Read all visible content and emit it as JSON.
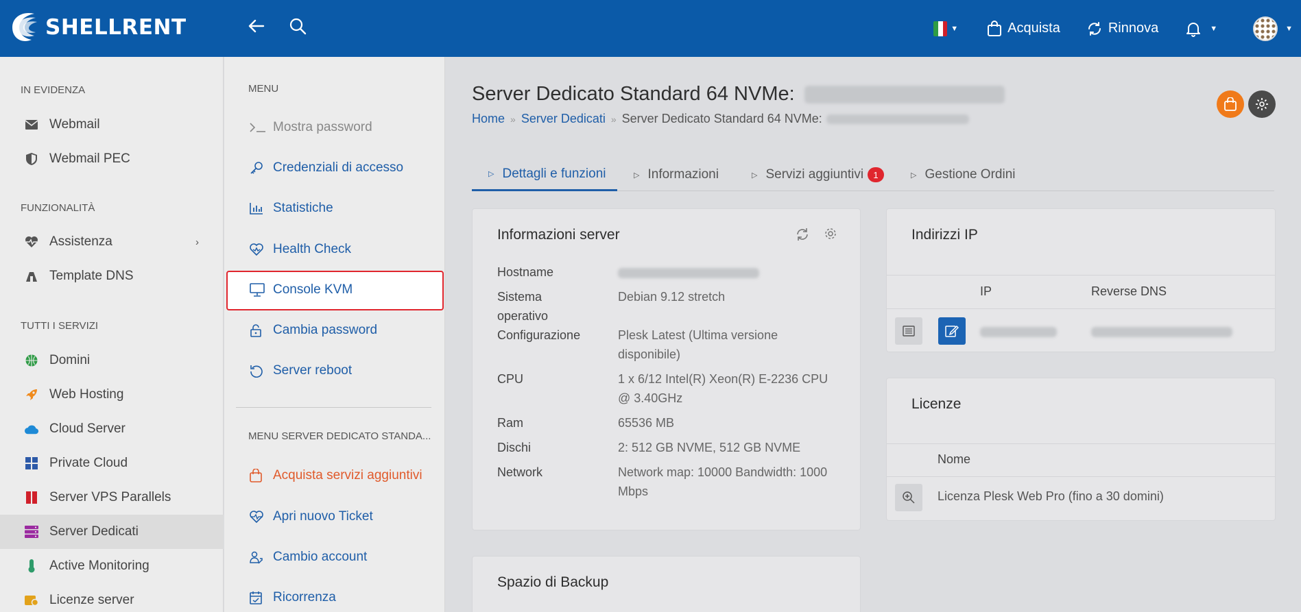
{
  "brand": {
    "name": "SHELLRENT"
  },
  "topbar": {
    "back_icon": "arrow-left-icon",
    "search_icon": "search-icon",
    "acquista_label": "Acquista",
    "rinnova_label": "Rinnova"
  },
  "sidebar": {
    "sections": {
      "evidenza": "IN EVIDENZA",
      "funzionalita": "FUNZIONALITÀ",
      "servizi": "TUTTI I SERVIZI"
    },
    "items": [
      {
        "label": "Webmail",
        "icon": "envelope-icon",
        "color": "#555555"
      },
      {
        "label": "Webmail PEC",
        "icon": "shield-icon",
        "color": "#555555"
      },
      {
        "label": "Assistenza",
        "icon": "heartbeat-icon",
        "color": "#555555"
      },
      {
        "label": "Template DNS",
        "icon": "dns-icon",
        "color": "#555555"
      },
      {
        "label": "Domini",
        "icon": "globe-icon",
        "color": "#2e9b45"
      },
      {
        "label": "Web Hosting",
        "icon": "rocket-icon",
        "color": "#f08a1c"
      },
      {
        "label": "Cloud Server",
        "icon": "cloud-icon",
        "color": "#1e8ad6"
      },
      {
        "label": "Private Cloud",
        "icon": "grid-icon",
        "color": "#2d5aa8"
      },
      {
        "label": "Server VPS Parallels",
        "icon": "parallels-icon",
        "color": "#d0202a"
      },
      {
        "label": "Server Dedicati",
        "icon": "server-icon",
        "color": "#9b2aa0"
      },
      {
        "label": "Active Monitoring",
        "icon": "thermometer-icon",
        "color": "#2e9b6a"
      },
      {
        "label": "Licenze server",
        "icon": "license-icon",
        "color": "#e2a21a"
      }
    ]
  },
  "menu": {
    "section1": "MENU",
    "items": [
      {
        "label": "Mostra password",
        "icon": "terminal-icon"
      },
      {
        "label": "Credenziali di accesso",
        "icon": "key-icon"
      },
      {
        "label": "Statistiche",
        "icon": "bar-chart-icon"
      },
      {
        "label": "Health Check",
        "icon": "heart-icon"
      },
      {
        "label": "Console KVM",
        "icon": "monitor-icon"
      },
      {
        "label": "Cambia password",
        "icon": "lock-icon"
      },
      {
        "label": "Server reboot",
        "icon": "reboot-icon"
      }
    ],
    "section2": "MENU SERVER DEDICATO STANDA...",
    "items2": [
      {
        "label": "Acquista servizi aggiuntivi",
        "icon": "bag-icon"
      },
      {
        "label": "Apri nuovo Ticket",
        "icon": "heartbeat-icon"
      },
      {
        "label": "Cambio account",
        "icon": "users-icon"
      },
      {
        "label": "Ricorrenza",
        "icon": "calendar-icon"
      }
    ]
  },
  "page": {
    "title": "Server Dedicato Standard 64 NVMe:",
    "breadcrumb": {
      "home": "Home",
      "section": "Server Dedicati",
      "current": "Server Dedicato Standard 64 NVMe:"
    }
  },
  "tabs": [
    {
      "label": "Dettagli e funzioni"
    },
    {
      "label": "Informazioni"
    },
    {
      "label": "Servizi aggiuntivi",
      "badge": "1"
    },
    {
      "label": "Gestione Ordini"
    }
  ],
  "server_info": {
    "title": "Informazioni server",
    "rows": [
      {
        "label": "Hostname",
        "value": ""
      },
      {
        "label": "Sistema operativo",
        "value": "Debian 9.12 stretch"
      },
      {
        "label": "Configurazione",
        "value": "Plesk Latest (Ultima versione disponibile)"
      },
      {
        "label": "CPU",
        "value": "1 x 6/12 Intel(R) Xeon(R) E-2236 CPU @ 3.40GHz"
      },
      {
        "label": "Ram",
        "value": "65536 MB"
      },
      {
        "label": "Dischi",
        "value": "2: 512 GB NVME, 512 GB NVME"
      },
      {
        "label": "Network",
        "value": "Network map: 10000 Bandwidth: 1000 Mbps"
      }
    ]
  },
  "ip": {
    "title": "Indirizzi IP",
    "col_ip": "IP",
    "col_dns": "Reverse DNS"
  },
  "licenze": {
    "title": "Licenze",
    "col_nome": "Nome",
    "row": "Licenza Plesk Web Pro (fino a 30 domini)"
  },
  "backup": {
    "title": "Spazio di Backup"
  },
  "colors": {
    "primary": "#0b5aa8",
    "accent_orange": "#f07a1a",
    "alert_red": "#e0262e"
  }
}
